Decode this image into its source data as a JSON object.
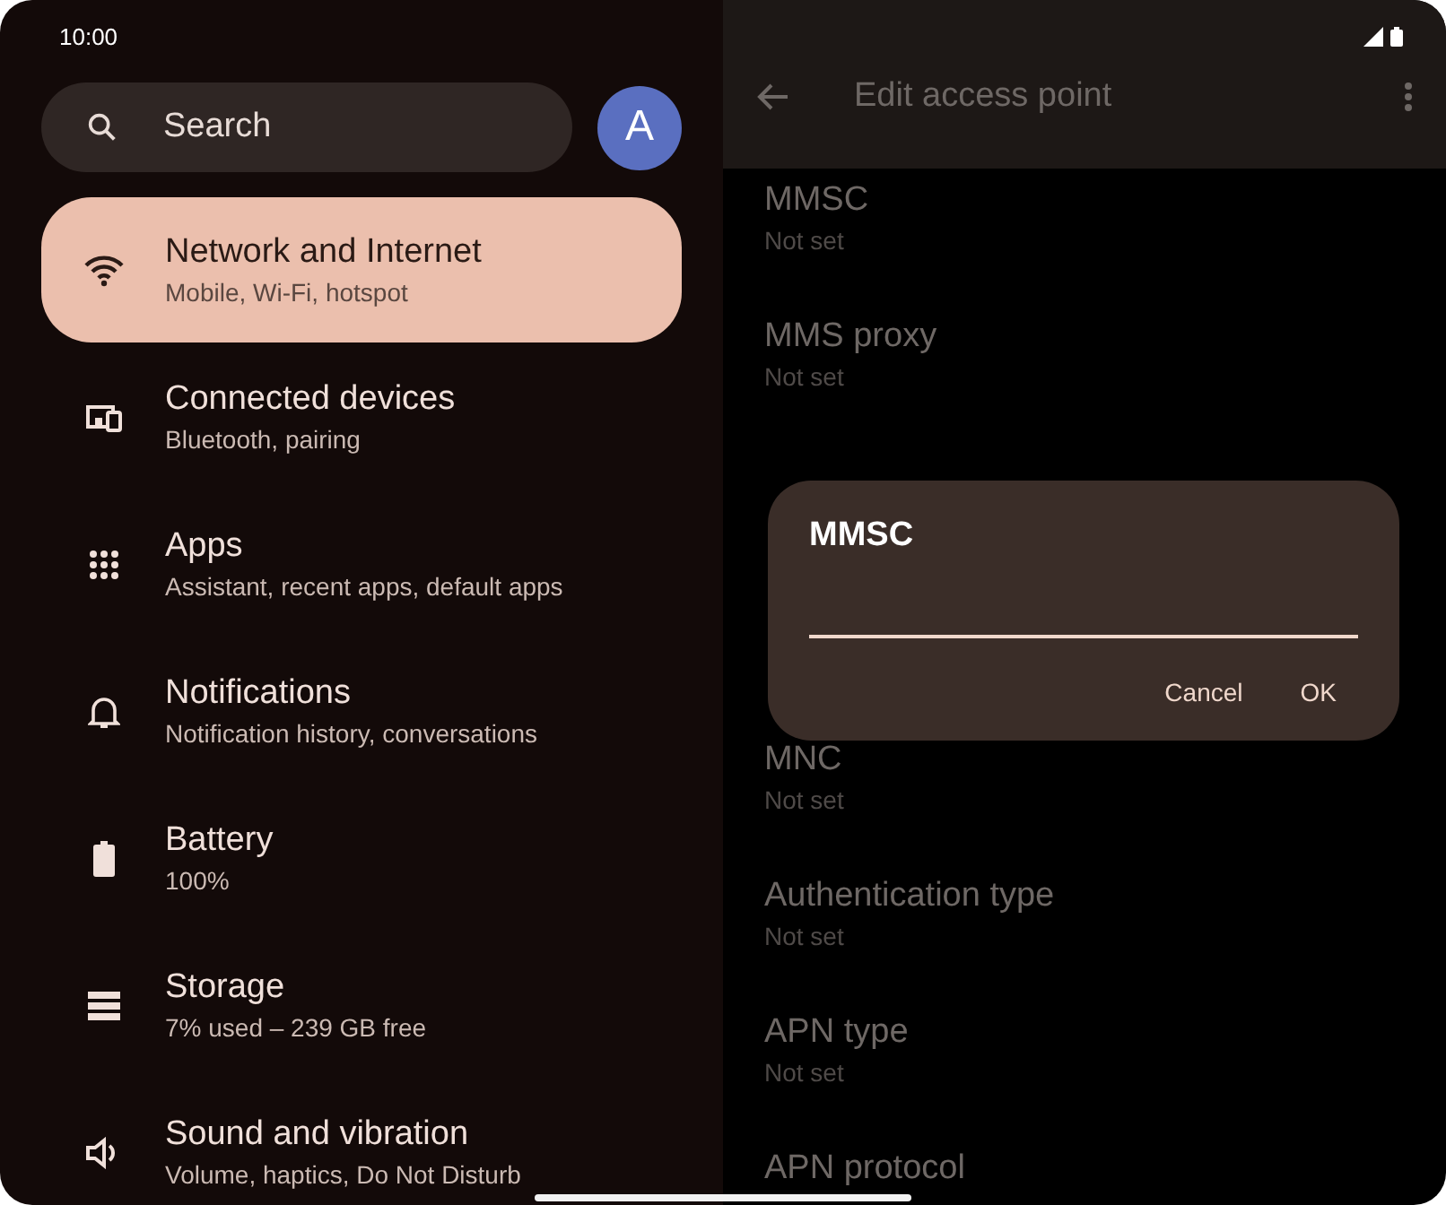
{
  "status_bar": {
    "time": "10:00"
  },
  "search": {
    "placeholder": "Search"
  },
  "avatar": {
    "initial": "A"
  },
  "settings": [
    {
      "title": "Network and Internet",
      "subtitle": "Mobile, Wi-Fi, hotspot",
      "selected": true
    },
    {
      "title": "Connected devices",
      "subtitle": "Bluetooth, pairing",
      "selected": false
    },
    {
      "title": "Apps",
      "subtitle": "Assistant, recent apps, default apps",
      "selected": false
    },
    {
      "title": "Notifications",
      "subtitle": "Notification history, conversations",
      "selected": false
    },
    {
      "title": "Battery",
      "subtitle": "100%",
      "selected": false
    },
    {
      "title": "Storage",
      "subtitle": "7% used – 239 GB free",
      "selected": false
    },
    {
      "title": "Sound and vibration",
      "subtitle": "Volume, haptics, Do Not Disturb",
      "selected": false
    }
  ],
  "app_bar": {
    "title": "Edit access point"
  },
  "fields": [
    {
      "label": "MMSC",
      "value": "Not set"
    },
    {
      "label": "MMS proxy",
      "value": "Not set"
    },
    {
      "label": "MNC",
      "value": "Not set"
    },
    {
      "label": "Authentication type",
      "value": "Not set"
    },
    {
      "label": "APN type",
      "value": "Not set"
    },
    {
      "label": "APN protocol"
    }
  ],
  "dialog": {
    "title": "MMSC",
    "buttons": [
      "Cancel",
      "OK"
    ]
  }
}
